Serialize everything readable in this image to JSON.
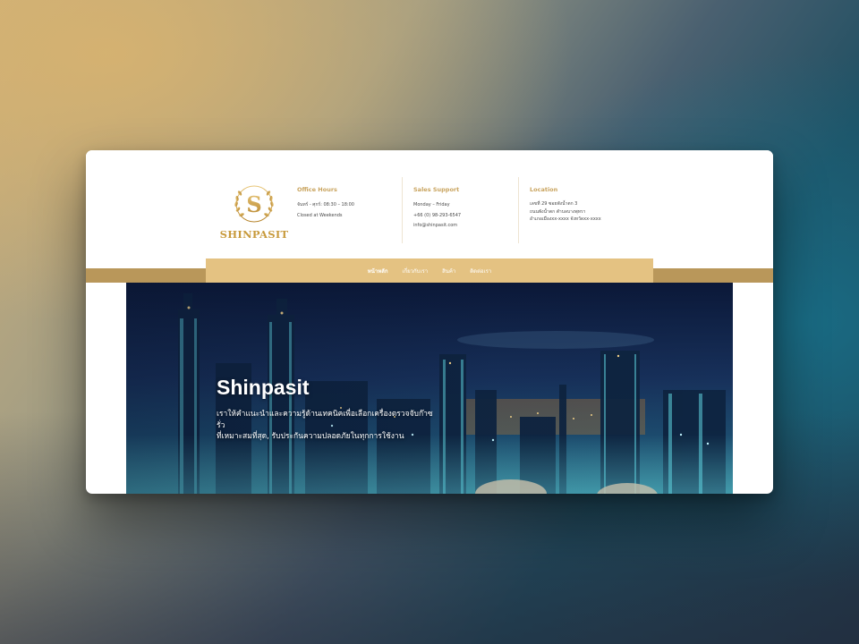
{
  "brand": {
    "name": "SHINPASIT"
  },
  "info": [
    {
      "title": "Office Hours",
      "lines": [
        "จันทร์ - ศุกร์: 08:30 – 18:00",
        "Closed at Weekends"
      ]
    },
    {
      "title": "Sales Support",
      "lines": [
        "Monday – Friday",
        "+66 (0) 98-293-6547",
        "info@shinpasit.com"
      ]
    },
    {
      "title": "Location",
      "lines": [
        "เลขที่ 29 ซอยพังน้ำตก 3",
        "ถนนพังน้ำตก ตำบลบางพุทรา",
        "อำเภอเมืองxx-xxxx จังหวัดxx-xxxx"
      ]
    }
  ],
  "nav": [
    {
      "label": "หน้าหลัก",
      "active": true
    },
    {
      "label": "เกี่ยวกับเรา",
      "active": false
    },
    {
      "label": "สินค้า",
      "active": false
    },
    {
      "label": "ติดต่อเรา",
      "active": false
    }
  ],
  "hero": {
    "title": "Shinpasit",
    "subtitle_line1": "เราให้คำแนะนำและความรู้ด้านเทคนิคเพื่อเลือกเครื่องตรวจจับก๊าซรั่ว",
    "subtitle_line2": "ที่เหมาะสมที่สุด, รับประกันความปลอดภัยในทุกการใช้งาน"
  },
  "colors": {
    "gold": "#c9a45f",
    "nav_bg": "#e4c282",
    "band": "#b9975a"
  }
}
